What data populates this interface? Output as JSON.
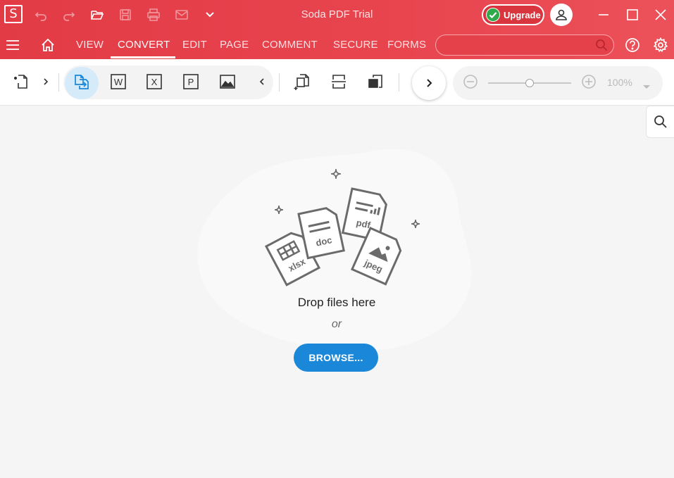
{
  "app": {
    "title": "Soda PDF Trial",
    "logo_letter": "S",
    "brand_color": "#e23b46",
    "accent_color": "#1a87d8"
  },
  "titlebar": {
    "quick_access": [
      {
        "icon": "undo-icon"
      },
      {
        "icon": "redo-icon"
      },
      {
        "icon": "open-folder-icon"
      },
      {
        "icon": "save-icon"
      },
      {
        "icon": "print-icon"
      },
      {
        "icon": "email-icon"
      },
      {
        "icon": "chevron-down-icon"
      }
    ],
    "upgrade_label": "Upgrade",
    "window_controls": [
      "minimize-icon",
      "maximize-icon",
      "close-icon"
    ]
  },
  "menubar": {
    "tabs": [
      {
        "label": "VIEW"
      },
      {
        "label": "CONVERT"
      },
      {
        "label": "EDIT"
      },
      {
        "label": "PAGE"
      },
      {
        "label": "COMMENT"
      },
      {
        "label": "SECURE"
      },
      {
        "label": "FORMS"
      }
    ],
    "active_tab": "CONVERT",
    "search_placeholder": ""
  },
  "toolbar": {
    "format_letters": {
      "word": "W",
      "excel": "X",
      "powerpoint": "P"
    },
    "zoom_value": "100%"
  },
  "dropzone": {
    "file_labels": {
      "xlsx": "xlsx",
      "doc": "doc",
      "pdf": "pdf",
      "jpeg": "jpeg"
    },
    "drop_text": "Drop files here",
    "or_text": "or",
    "browse_label": "BROWSE..."
  }
}
